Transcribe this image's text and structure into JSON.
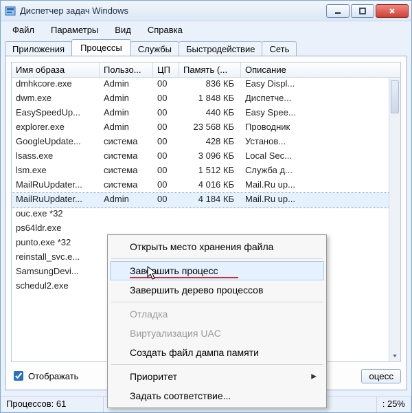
{
  "window": {
    "title": "Диспетчер задач Windows"
  },
  "menu": [
    "Файл",
    "Параметры",
    "Вид",
    "Справка"
  ],
  "tabs": {
    "items": [
      "Приложения",
      "Процессы",
      "Службы",
      "Быстродействие",
      "Сеть"
    ],
    "active": 1
  },
  "columns": [
    "Имя образа",
    "Пользо...",
    "ЦП",
    "Память (...",
    "Описание"
  ],
  "processes": [
    {
      "name": "dmhkcore.exe",
      "user": "Admin",
      "cpu": "00",
      "mem": "836 КБ",
      "desc": "Easy Displ..."
    },
    {
      "name": "dwm.exe",
      "user": "Admin",
      "cpu": "00",
      "mem": "1 848 КБ",
      "desc": "Диспетче..."
    },
    {
      "name": "EasySpeedUp...",
      "user": "Admin",
      "cpu": "00",
      "mem": "440 КБ",
      "desc": "Easy Spee..."
    },
    {
      "name": "explorer.exe",
      "user": "Admin",
      "cpu": "00",
      "mem": "23 568 КБ",
      "desc": "Проводник"
    },
    {
      "name": "GoogleUpdate...",
      "user": "система",
      "cpu": "00",
      "mem": "428 КБ",
      "desc": "Установ..."
    },
    {
      "name": "lsass.exe",
      "user": "система",
      "cpu": "00",
      "mem": "3 096 КБ",
      "desc": "Local Sec..."
    },
    {
      "name": "lsm.exe",
      "user": "система",
      "cpu": "00",
      "mem": "1 512 КБ",
      "desc": "Служба д..."
    },
    {
      "name": "MailRuUpdater...",
      "user": "система",
      "cpu": "00",
      "mem": "4 016 КБ",
      "desc": "Mail.Ru up..."
    },
    {
      "name": "MailRuUpdater...",
      "user": "Admin",
      "cpu": "00",
      "mem": "4 184 КБ",
      "desc": "Mail.Ru up...",
      "selected": true
    },
    {
      "name": "ouc.exe *32",
      "user": "",
      "cpu": "",
      "mem": "",
      "desc": ""
    },
    {
      "name": "ps64ldr.exe",
      "user": "",
      "cpu": "",
      "mem": "",
      "desc": ""
    },
    {
      "name": "punto.exe *32",
      "user": "",
      "cpu": "",
      "mem": "",
      "desc": ""
    },
    {
      "name": "reinstall_svc.e...",
      "user": "",
      "cpu": "",
      "mem": "",
      "desc": ""
    },
    {
      "name": "SamsungDevi...",
      "user": "",
      "cpu": "",
      "mem": "",
      "desc": ""
    },
    {
      "name": "schedul2.exe",
      "user": "",
      "cpu": "",
      "mem": "",
      "desc": ""
    }
  ],
  "footer": {
    "checkbox_label": "Отображать",
    "end_button_truncated": "оцесс"
  },
  "status": {
    "processes": "Процессов: 61",
    "cpu": ": 25%"
  },
  "context_menu": {
    "open_location": "Открыть место хранения файла",
    "end_process": "Завершить процесс",
    "end_tree": "Завершить дерево процессов",
    "debug": "Отладка",
    "uac": "Виртуализация UAC",
    "dump": "Создать файл дампа памяти",
    "priority": "Приоритет",
    "affinity": "Задать соответствие..."
  }
}
